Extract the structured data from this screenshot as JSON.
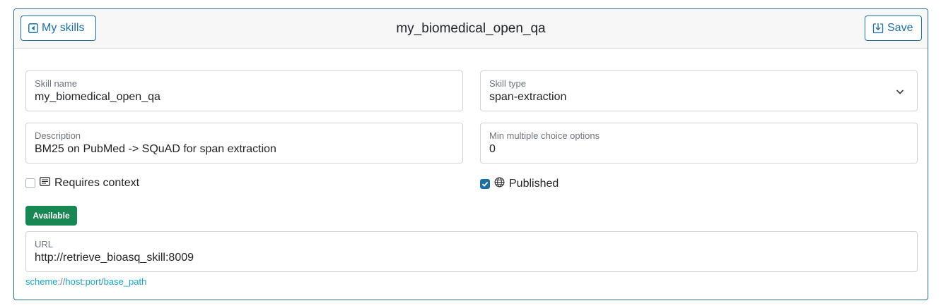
{
  "header": {
    "back_label": "My skills",
    "title": "my_biomedical_open_qa",
    "save_label": "Save"
  },
  "fields": {
    "skill_name": {
      "label": "Skill name",
      "value": "my_biomedical_open_qa"
    },
    "skill_type": {
      "label": "Skill type",
      "value": "span-extraction"
    },
    "description": {
      "label": "Description",
      "value": "BM25 on PubMed -> SQuAD for span extraction"
    },
    "min_options": {
      "label": "Min multiple choice options",
      "value": "0"
    },
    "url": {
      "label": "URL",
      "value": "http://retrieve_bioasq_skill:8009"
    }
  },
  "checkboxes": {
    "requires_context": {
      "label": "Requires context",
      "checked": false
    },
    "published": {
      "label": "Published",
      "checked": true
    }
  },
  "status_badge": "Available",
  "url_hint": {
    "scheme": "scheme",
    "sep1": "://",
    "host": "host",
    "sep2": ":",
    "port": "port",
    "sep3": "/",
    "base_path": "base_path"
  },
  "colors": {
    "accent": "#1f6fa1",
    "success": "#198754",
    "hint": "#1aa3c7"
  },
  "icons": [
    "caret-left-icon",
    "save-download-icon",
    "chevron-down-icon",
    "text-lines-icon",
    "globe-icon",
    "checkmark-icon"
  ]
}
